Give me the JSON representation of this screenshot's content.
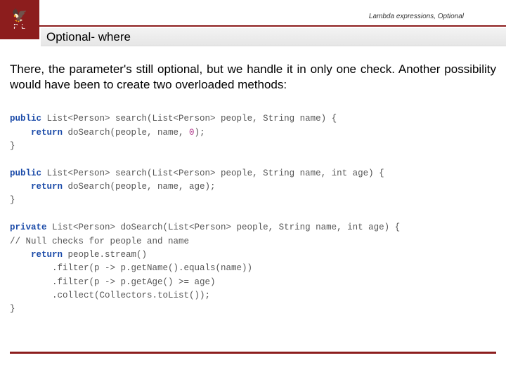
{
  "top": {
    "label": "Lambda expressions, Optional",
    "logo_letters": "P Ł"
  },
  "heading": "Optional- where",
  "paragraph": "There, the parameter's still optional, but we handle it in only one check. Another possibility would have been to create two overloaded methods:",
  "code": {
    "l1_public": "public",
    "l1_rest": " List<Person> search(List<Person> people, String name) {",
    "l2_return": "    return",
    "l2_rest": " doSearch(people, name, ",
    "l2_zero": "0",
    "l2_end": ");",
    "l3": "}",
    "blank1": "",
    "l4_public": "public",
    "l4_rest": " List<Person> search(List<Person> people, String name, int age) {",
    "l5_return": "    return",
    "l5_rest": " doSearch(people, name, age);",
    "l6": "}",
    "blank2": "",
    "l7_private": "private",
    "l7_rest": " List<Person> doSearch(List<Person> people, String name, int age) {",
    "l8": "// Null checks for people and name",
    "l9_return": "    return",
    "l9_rest": " people.stream()",
    "l10": "        .filter(p -> p.getName().equals(name))",
    "l11": "        .filter(p -> p.getAge() >= age)",
    "l12": "        .collect(Collectors.toList());",
    "l13": "}"
  }
}
